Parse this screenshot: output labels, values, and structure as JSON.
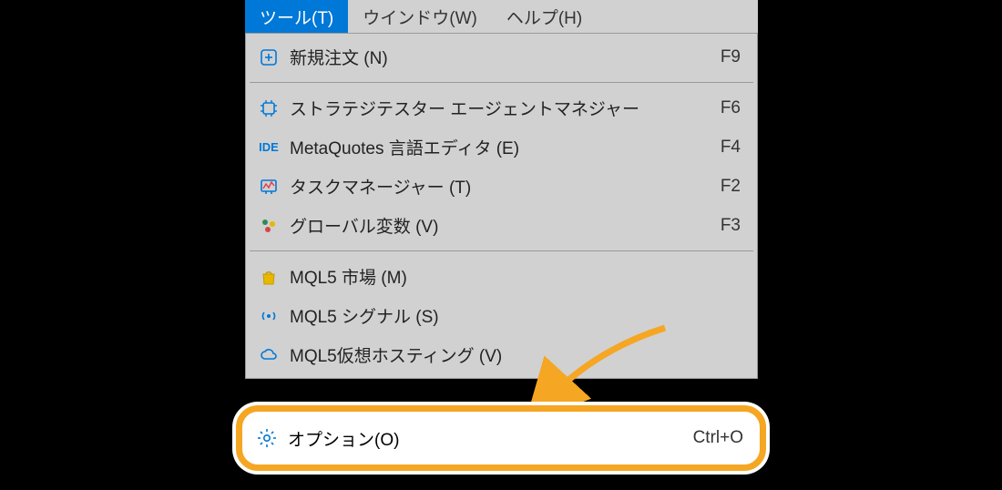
{
  "menubar": {
    "tools": "ツール(T)",
    "window": "ウインドウ(W)",
    "help": "ヘルプ(H)"
  },
  "menu": {
    "newOrder": {
      "label": "新規注文 (N)",
      "shortcut": "F9"
    },
    "strategyTester": {
      "label": "ストラテジテスター エージェントマネジャー",
      "shortcut": "F6"
    },
    "metaEditor": {
      "label": "MetaQuotes 言語エディタ (E)",
      "shortcut": "F4"
    },
    "taskManager": {
      "label": "タスクマネージャー (T)",
      "shortcut": "F2"
    },
    "globalVars": {
      "label": "グローバル変数 (V)",
      "shortcut": "F3"
    },
    "mql5Market": {
      "label": "MQL5 市場 (M)"
    },
    "mql5Signals": {
      "label": "MQL5 シグナル (S)"
    },
    "mql5Hosting": {
      "label": "MQL5仮想ホスティング (V)"
    },
    "options": {
      "label": "オプション(O)",
      "shortcut": "Ctrl+O"
    }
  },
  "icons": {
    "ide": "IDE"
  }
}
